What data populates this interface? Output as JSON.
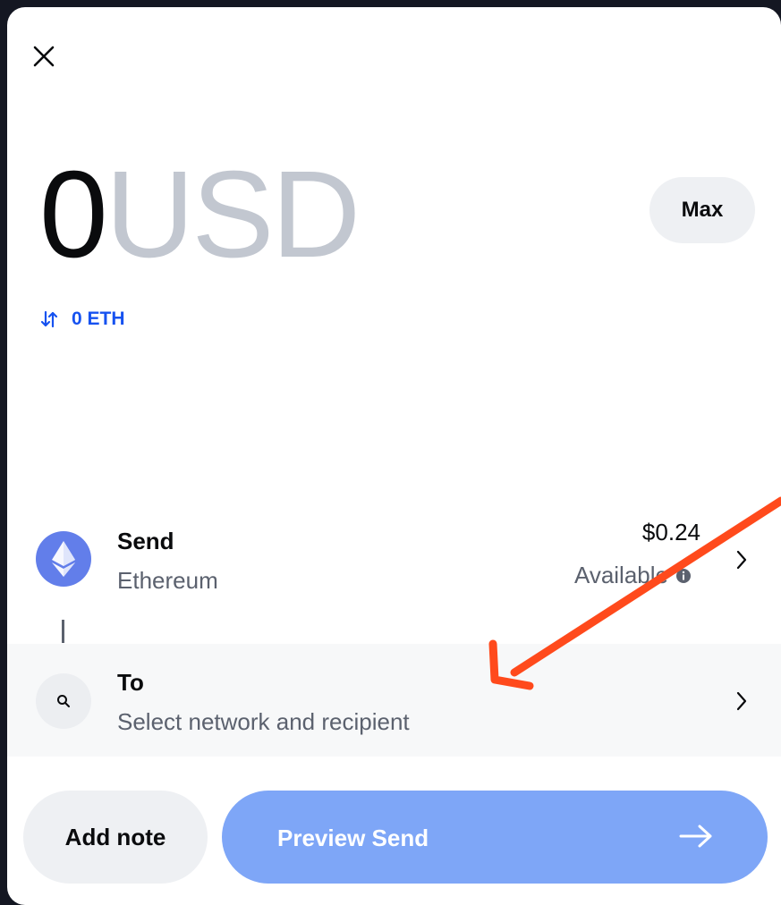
{
  "header": {
    "close_icon": "close-icon"
  },
  "amount": {
    "value": "0",
    "currency": "USD",
    "max_label": "Max"
  },
  "conversion": {
    "icon": "swap-arrows-icon",
    "text": "0 ETH"
  },
  "send": {
    "title": "Send",
    "asset": "Ethereum",
    "balance": "$0.24",
    "balance_label": "Available",
    "icon": "ethereum-icon"
  },
  "to": {
    "title": "To",
    "subtitle": "Select network and recipient",
    "icon": "search-icon"
  },
  "footer": {
    "note_label": "Add note",
    "preview_label": "Preview Send"
  },
  "colors": {
    "accent": "#1652f0",
    "primary_button": "#7ea6f7",
    "annotation_arrow": "#ff4a1c",
    "ethereum": "#627eea"
  }
}
